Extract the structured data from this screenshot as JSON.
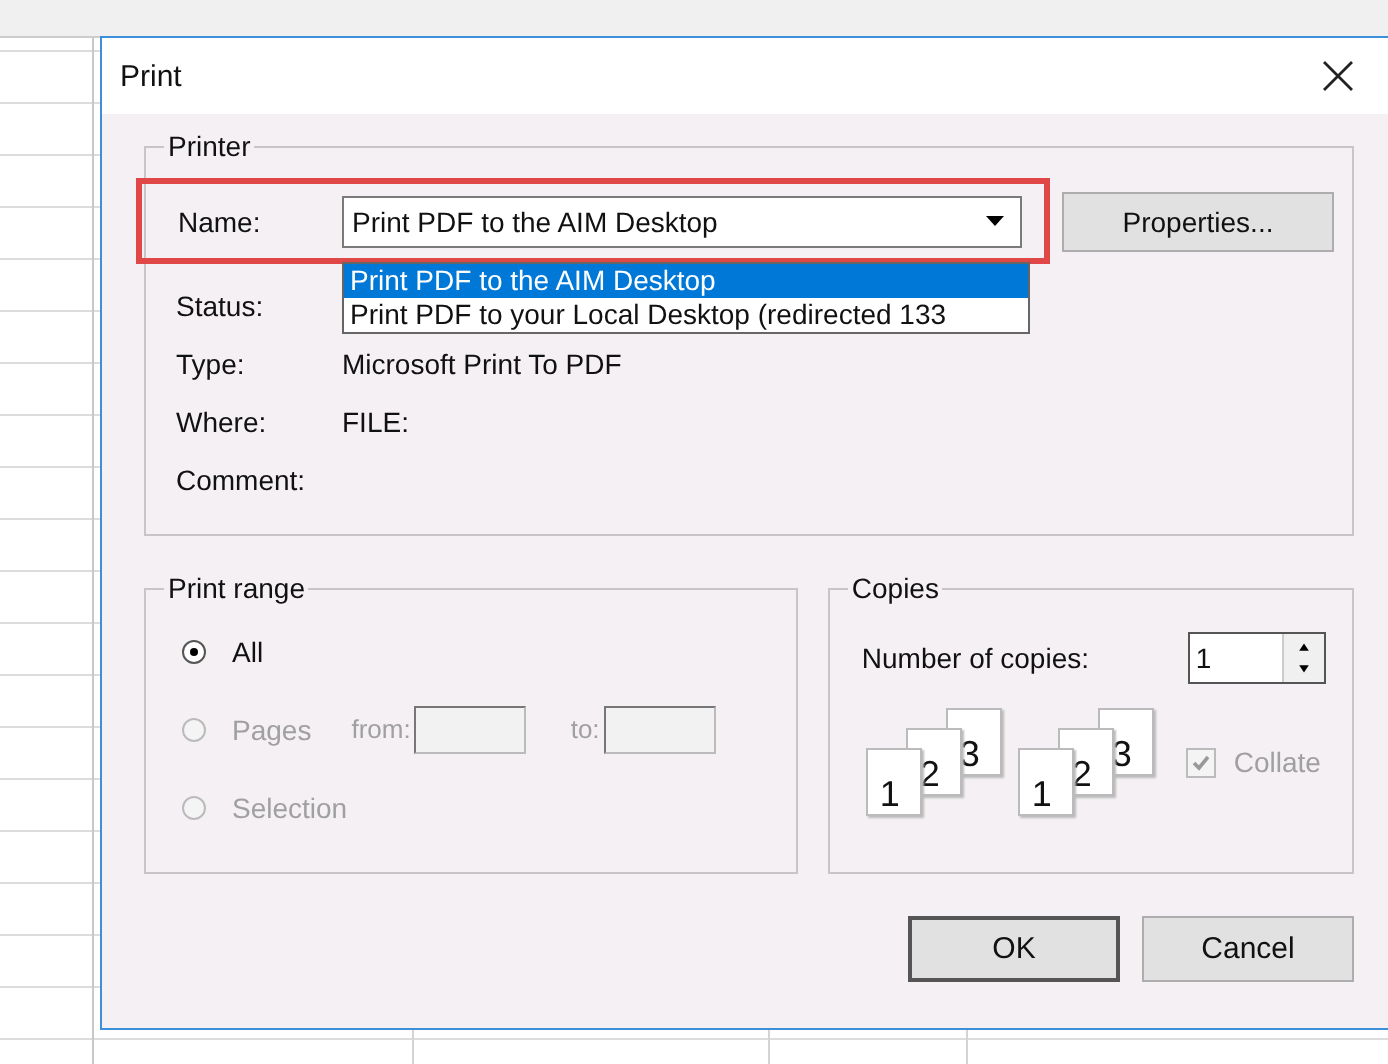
{
  "window": {
    "title": "Print"
  },
  "printer": {
    "legend": "Printer",
    "name_label": "Name:",
    "name_value": "Print PDF to the AIM Desktop",
    "name_row_highlighted": true,
    "dropdown_options": [
      {
        "label": "Print PDF to the AIM Desktop",
        "selected": true
      },
      {
        "label": "Print PDF to your Local Desktop (redirected 133",
        "selected": false
      }
    ],
    "properties_button": "Properties...",
    "fields": [
      {
        "label": "Status:"
      },
      {
        "label": "Type:",
        "value": "Microsoft Print To PDF"
      },
      {
        "label": "Where:",
        "value": "FILE:"
      },
      {
        "label": "Comment:"
      }
    ]
  },
  "print_range": {
    "legend": "Print range",
    "from_label": "from:",
    "to_label": "to:",
    "options": [
      {
        "label": "All",
        "selected": true,
        "disabled": false
      },
      {
        "label": "Pages",
        "selected": false,
        "disabled": true
      },
      {
        "label": "Selection",
        "selected": false,
        "disabled": true
      }
    ]
  },
  "copies": {
    "legend": "Copies",
    "label": "Number of copies:",
    "value": "1",
    "page_stacks": [
      [
        "1",
        "2",
        "3"
      ],
      [
        "1",
        "2",
        "3"
      ]
    ],
    "collate": {
      "label": "Collate",
      "checked": true,
      "disabled": true
    }
  },
  "buttons": [
    "OK",
    "Cancel"
  ]
}
